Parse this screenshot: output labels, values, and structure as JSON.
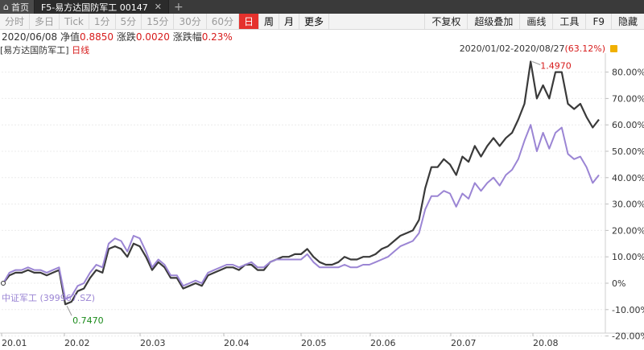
{
  "tabs": {
    "home_label": "首页",
    "active_label": "F5-易方达国防军工 00147",
    "close_glyph": "✕",
    "add_glyph": "+"
  },
  "periods": [
    {
      "label": "分时",
      "state": "disabled"
    },
    {
      "label": "多日",
      "state": "disabled"
    },
    {
      "label": "Tick",
      "state": "disabled"
    },
    {
      "label": "1分",
      "state": "disabled"
    },
    {
      "label": "5分",
      "state": "disabled"
    },
    {
      "label": "15分",
      "state": "disabled"
    },
    {
      "label": "30分",
      "state": "disabled"
    },
    {
      "label": "60分",
      "state": "disabled"
    },
    {
      "label": "日",
      "state": "active"
    },
    {
      "label": "周",
      "state": "enabled"
    },
    {
      "label": "月",
      "state": "enabled"
    },
    {
      "label": "更多",
      "state": "enabled"
    }
  ],
  "tools": [
    "不复权",
    "超级叠加",
    "画线",
    "工具",
    "F9",
    "隐藏"
  ],
  "info": {
    "date": "2020/06/08",
    "nav_label": "净值",
    "nav_value": "0.8850",
    "change_label": "涨跌",
    "change_value": "0.0020",
    "pct_label": "涨跌幅",
    "pct_value": "0.23%"
  },
  "title": {
    "name": "[易方达国防军工]",
    "period": "日线"
  },
  "range": {
    "text": "2020/01/02-2020/08/27",
    "gain": "(63.12%)"
  },
  "colors": {
    "fund_line": "#3a3a3a",
    "index_line": "#9b85d4",
    "up": "#d71b1b",
    "down": "#1a8a1a",
    "active_tab": "#e5312d"
  },
  "chart_data": {
    "type": "line",
    "x": [
      "20.01",
      "20.02",
      "20.03",
      "20.04",
      "20.05",
      "20.06",
      "20.07",
      "20.08"
    ],
    "y_ticks": [
      "80.00%",
      "70.00%",
      "60.00%",
      "50.00%",
      "40.00%",
      "30.00%",
      "20.00%",
      "10.00%",
      "0%",
      "-10.00%",
      "-20.00%"
    ],
    "ylim": [
      -20,
      85
    ],
    "series": [
      {
        "name": "",
        "values": [
          0,
          3,
          4,
          4,
          5,
          4,
          4,
          3,
          4,
          5,
          -8,
          -7,
          -3,
          -2,
          2,
          5,
          4,
          13,
          14,
          13,
          10,
          15,
          14,
          10,
          5,
          8,
          6,
          2,
          2,
          -2,
          -1,
          0,
          -1,
          3,
          4,
          5,
          6,
          6,
          5,
          7,
          7,
          5,
          5,
          8,
          9,
          10,
          10,
          11,
          11,
          13,
          10,
          8,
          7,
          7,
          8,
          10,
          9,
          9,
          10,
          10,
          11,
          13,
          14,
          16,
          18,
          19,
          20,
          24,
          36,
          44,
          44,
          47,
          45,
          41,
          48,
          46,
          52,
          48,
          52,
          55,
          52,
          55,
          57,
          62,
          68,
          84,
          70,
          75,
          70,
          80,
          80,
          68,
          66,
          68,
          63,
          59,
          62
        ]
      },
      {
        "name": "中证军工 (399967.SZ)",
        "values": [
          0,
          4,
          5,
          5,
          6,
          5,
          5,
          4,
          5,
          6,
          -6,
          -5,
          -1,
          0,
          4,
          7,
          6,
          15,
          17,
          16,
          12,
          18,
          17,
          12,
          6,
          9,
          7,
          3,
          3,
          -1,
          0,
          1,
          0,
          4,
          5,
          6,
          7,
          7,
          6,
          7,
          8,
          6,
          6,
          8,
          9,
          9,
          9,
          9,
          9,
          11,
          8,
          6,
          6,
          6,
          6,
          7,
          6,
          6,
          7,
          7,
          8,
          9,
          10,
          12,
          14,
          15,
          16,
          19,
          28,
          33,
          33,
          35,
          34,
          29,
          34,
          32,
          38,
          35,
          38,
          40,
          37,
          41,
          43,
          47,
          54,
          60,
          50,
          57,
          51,
          57,
          59,
          49,
          47,
          48,
          44,
          38,
          41
        ]
      }
    ],
    "annotations": [
      {
        "label": "1.4970",
        "type": "max",
        "color": "up"
      },
      {
        "label": "0.7470",
        "type": "min",
        "color": "down"
      }
    ],
    "grid": true,
    "legend": "bottom-left"
  }
}
